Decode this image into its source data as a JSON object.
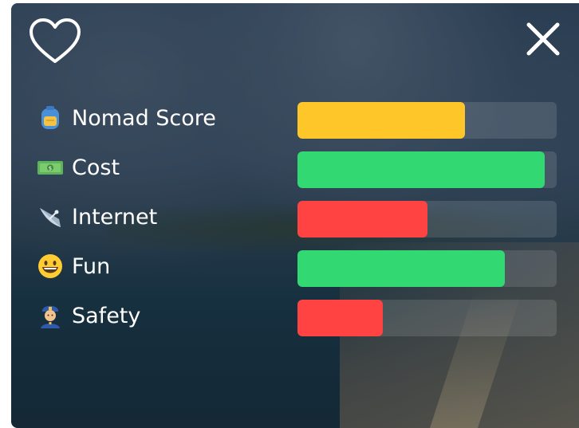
{
  "card": {
    "favorite_icon": "heart-outline-icon",
    "close_icon": "close-x-icon"
  },
  "ratings": [
    {
      "label": "Nomad Score",
      "icon": "backpack-emoji-icon",
      "level": 0.645,
      "color": "#FFC629"
    },
    {
      "label": "Cost",
      "icon": "money-emoji-icon",
      "level": 0.955,
      "color": "#32D872"
    },
    {
      "label": "Internet",
      "icon": "satellite-dish-emoji-icon",
      "level": 0.5,
      "color": "#FF4242"
    },
    {
      "label": "Fun",
      "icon": "grinning-face-emoji-icon",
      "level": 0.8,
      "color": "#32D872"
    },
    {
      "label": "Safety",
      "icon": "police-officer-emoji-icon",
      "level": 0.33,
      "color": "#FF4242"
    }
  ]
}
